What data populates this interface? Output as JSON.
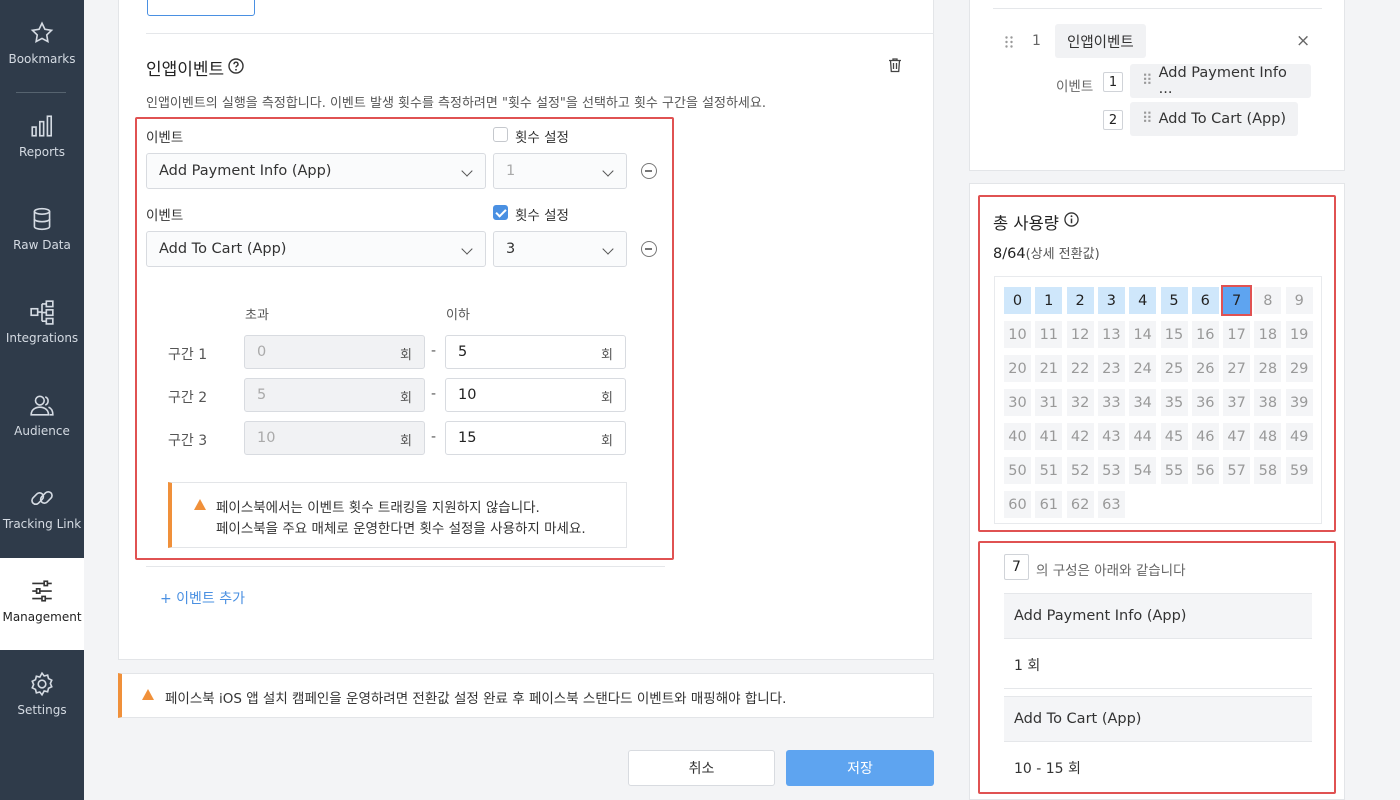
{
  "sidebar": {
    "items": [
      {
        "label": "Bookmarks",
        "icon": "star-icon"
      },
      {
        "label": "Reports",
        "icon": "bar-chart-icon"
      },
      {
        "label": "Raw Data",
        "icon": "database-icon"
      },
      {
        "label": "Integrations",
        "icon": "hierarchy-icon"
      },
      {
        "label": "Audience",
        "icon": "users-icon"
      },
      {
        "label": "Tracking Link",
        "icon": "link-icon"
      },
      {
        "label": "Management",
        "icon": "sliders-icon",
        "active": true
      },
      {
        "label": "Settings",
        "icon": "gear-icon"
      }
    ]
  },
  "inapp": {
    "title": "인앱이벤트",
    "description": "인앱이벤트의 실행을 측정합니다. 이벤트 발생 횟수를 측정하려면 \"횟수 설정\"을 선택하고 횟수 구간을 설정하세요.",
    "events": [
      {
        "label": "이벤트",
        "value": "Add Payment Info (App)",
        "count_label": "횟수 설정",
        "count_checked": false,
        "count_value": "1"
      },
      {
        "label": "이벤트",
        "value": "Add To Cart (App)",
        "count_label": "횟수 설정",
        "count_checked": true,
        "count_value": "3"
      }
    ],
    "range_headers": {
      "over": "초과",
      "under": "이하"
    },
    "unit": "회",
    "ranges": [
      {
        "label": "구간 1",
        "from": "0",
        "to": "5"
      },
      {
        "label": "구간 2",
        "from": "5",
        "to": "10"
      },
      {
        "label": "구간 3",
        "from": "10",
        "to": "15"
      }
    ],
    "dash": "-",
    "warning_line1": "페이스북에서는 이벤트 횟수 트래킹을 지원하지 않습니다.",
    "warning_line2": "페이스북을 주요 매체로 운영한다면 횟수 설정을 사용하지 마세요.",
    "add_event": "+ 이벤트 추가"
  },
  "bottom_warning": "페이스북 iOS 앱 설치 캠페인을 운영하려면 전환값 설정 완료 후 페이스북 스탠다드 이벤트와 매핑해야 합니다.",
  "buttons": {
    "cancel": "취소",
    "save": "저장"
  },
  "preview": {
    "index": "1",
    "name": "인앱이벤트",
    "event_label": "이벤트",
    "items": [
      {
        "num": "1",
        "name": "Add Payment Info ..."
      },
      {
        "num": "2",
        "name": "Add To Cart (App)"
      }
    ]
  },
  "usage": {
    "title": "총 사용량",
    "count": "8/64",
    "count_suffix": "(상세 전환값)",
    "used_max": 7,
    "selected": 7,
    "total": 64
  },
  "composition": {
    "value": "7",
    "text": "의 구성은 아래와 같습니다",
    "rows": [
      {
        "event": "Add Payment Info (App)",
        "value": "1 회"
      },
      {
        "event": "Add To Cart (App)",
        "value": "10 - 15 회"
      }
    ]
  },
  "colors": {
    "accent": "#4a90e2",
    "warning": "#f0903a",
    "highlight": "#e05252",
    "sidebar": "#2f3b4a"
  }
}
